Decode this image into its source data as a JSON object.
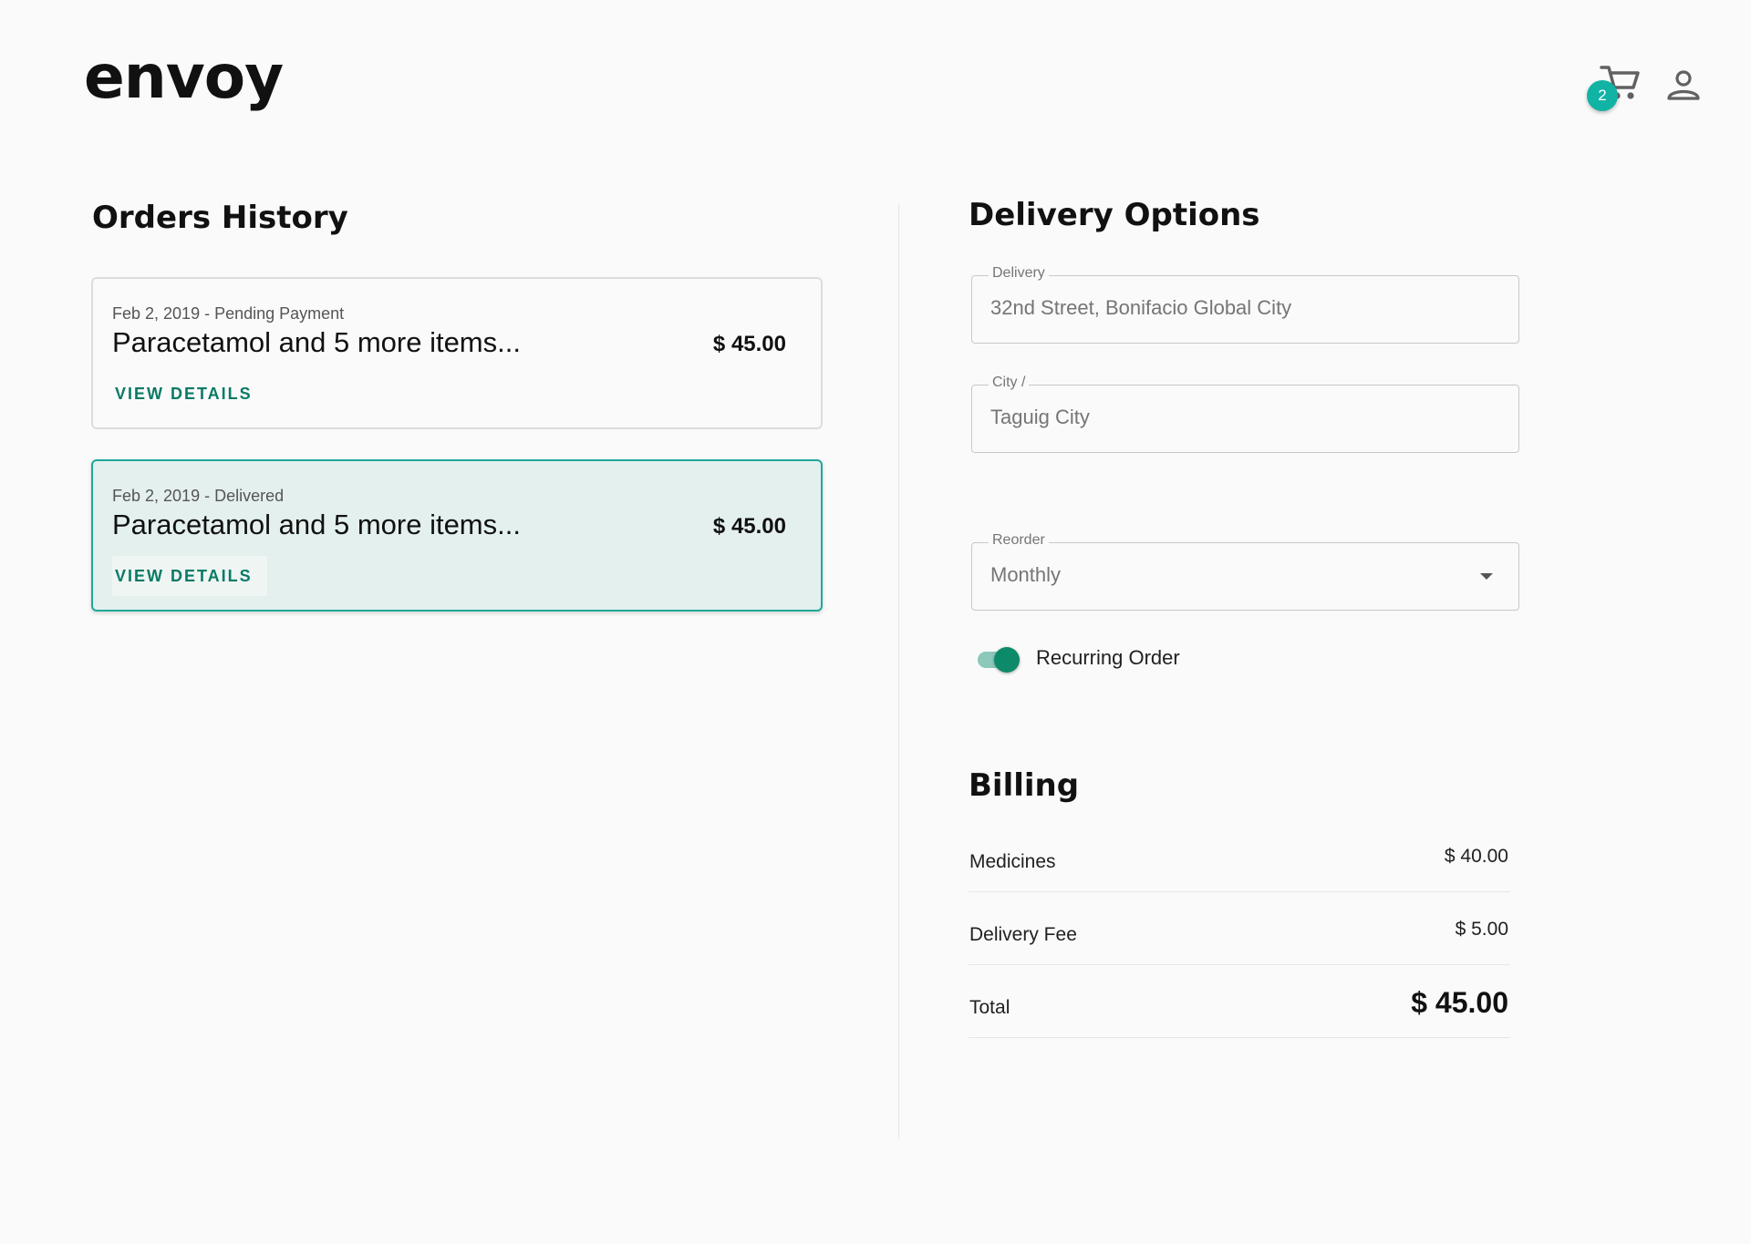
{
  "header": {
    "logo": "envoy",
    "cart_count": "2"
  },
  "orders": {
    "title": "Orders History",
    "items": [
      {
        "meta": "Feb 2, 2019 - Pending Payment",
        "name": "Paracetamol and 5 more items...",
        "price": "$ 45.00",
        "action": "VIEW DETAILS"
      },
      {
        "meta": "Feb 2, 2019 - Delivered",
        "name": "Paracetamol and 5 more items...",
        "price": "$ 45.00",
        "action": "VIEW DETAILS"
      }
    ]
  },
  "delivery": {
    "title": "Delivery Options",
    "address": {
      "label": "Delivery",
      "value": "32nd Street, Bonifacio Global City"
    },
    "city": {
      "label": "City /",
      "value": "Taguig City"
    },
    "reorder": {
      "label": "Reorder",
      "value": "Monthly"
    },
    "recurring": {
      "label": "Recurring Order",
      "on": true
    }
  },
  "billing": {
    "title": "Billing",
    "rows": [
      {
        "label": "Medicines",
        "amount": "$ 40.00"
      },
      {
        "label": "Delivery Fee",
        "amount": "$ 5.00"
      },
      {
        "label": "Total",
        "amount": "$ 45.00"
      }
    ]
  },
  "colors": {
    "accent": "#11b3a4",
    "link": "#0a7a66",
    "toggle_on": "#0d8a6a",
    "selected_card_bg": "#e4f0ee"
  }
}
